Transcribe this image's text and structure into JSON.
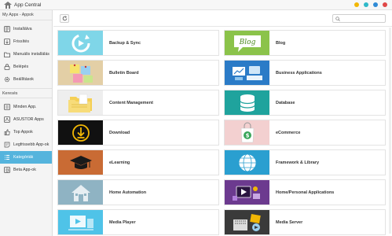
{
  "window": {
    "title": "App Central",
    "controls": [
      {
        "name": "minimize",
        "color": "#f2b705"
      },
      {
        "name": "tile",
        "color": "#2fb9c9"
      },
      {
        "name": "maximize",
        "color": "#2f8bd6"
      },
      {
        "name": "close",
        "color": "#e04848"
      }
    ]
  },
  "sidebar": {
    "section1_label": "My Apps - Appok",
    "section1_items": [
      {
        "label": "Installálva",
        "icon": "installed-icon"
      },
      {
        "label": "Frissítés",
        "icon": "update-icon"
      },
      {
        "label": "Manuális installálás",
        "icon": "manual-install-icon"
      },
      {
        "label": "Belépés",
        "icon": "login-icon"
      },
      {
        "label": "Beállítások",
        "icon": "gear-icon"
      }
    ],
    "section2_label": "Keresés",
    "section2_items": [
      {
        "label": "Minden App.",
        "icon": "all-apps-icon"
      },
      {
        "label": "ASUSTOR Apps",
        "icon": "asustor-icon"
      },
      {
        "label": "Top Appok",
        "icon": "thumbs-up-icon"
      },
      {
        "label": "Legfrissebb App-ok",
        "icon": "newest-icon"
      },
      {
        "label": "Kategóriák",
        "icon": "list-icon",
        "active": true
      },
      {
        "label": "Beta App-ok",
        "icon": "beta-icon"
      }
    ],
    "active_color": "#55b4dd"
  },
  "toolbar": {
    "search_placeholder": ""
  },
  "categories": [
    {
      "label": "Backup & Sync",
      "icon": "backup-sync-icon",
      "color": "#7fd6e8"
    },
    {
      "label": "Blog",
      "icon": "blog-icon",
      "color": "#8bc34a"
    },
    {
      "label": "Bulletin Board",
      "icon": "bulletin-board-icon",
      "color": "#e3cfa6"
    },
    {
      "label": "Business Applications",
      "icon": "business-icon",
      "color": "#2b7bc7"
    },
    {
      "label": "Content Management",
      "icon": "folders-icon",
      "color": "#eeeeee"
    },
    {
      "label": "Database",
      "icon": "database-icon",
      "color": "#1fa39d"
    },
    {
      "label": "Download",
      "icon": "download-icon",
      "color": "#111111"
    },
    {
      "label": "eCommerce",
      "icon": "shopping-bag-icon",
      "color": "#f3d0d0"
    },
    {
      "label": "eLearning",
      "icon": "graduation-cap-icon",
      "color": "#c96b34"
    },
    {
      "label": "Framework & Library",
      "icon": "globe-icon",
      "color": "#2a9fd0"
    },
    {
      "label": "Home Automation",
      "icon": "home-icon",
      "color": "#8fb3c3"
    },
    {
      "label": "Home/Personal Applications",
      "icon": "personal-apps-icon",
      "color": "#6c3a8f"
    },
    {
      "label": "Media Player",
      "icon": "media-player-icon",
      "color": "#4fc3e8"
    },
    {
      "label": "Media Server",
      "icon": "media-server-icon",
      "color": "#3a3a3a"
    }
  ]
}
